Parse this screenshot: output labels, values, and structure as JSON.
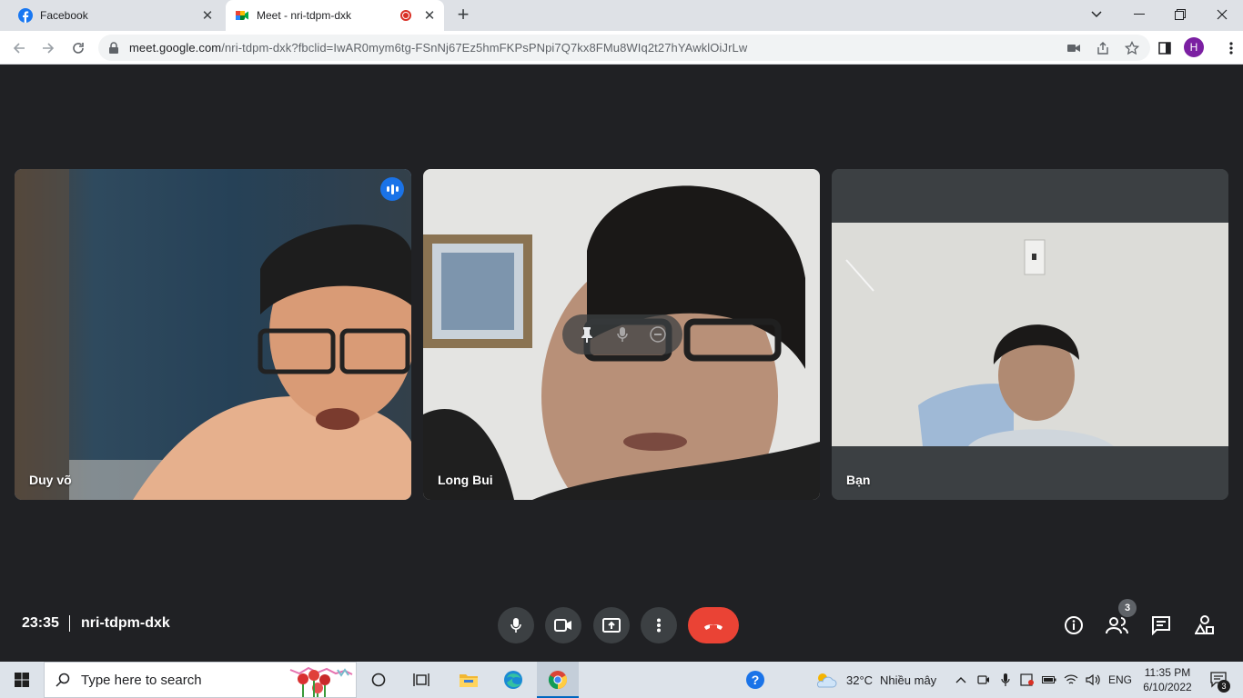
{
  "browser": {
    "tabs": [
      {
        "title": "Facebook",
        "favicon": "facebook-icon",
        "active": false
      },
      {
        "title": "Meet - nri-tdpm-dxk",
        "favicon": "google-meet-icon",
        "active": true,
        "recording_indicator": true
      }
    ],
    "url": {
      "host": "meet.google.com",
      "path": "/nri-tdpm-dxk?fbclid=IwAR0mym6tg-FSnNj67Ez5hmFKPsPNpi7Q7kx8FMu8WIq2t27hYAwklOiJrLw"
    },
    "profile_initial": "H"
  },
  "meeting": {
    "participants": [
      {
        "name": "Duy võ",
        "speaking": true,
        "avatar_color": "#3a4a5c"
      },
      {
        "name": "Long Bui",
        "speaking": false,
        "avatar_color": "#d8d8d6"
      },
      {
        "name": "Bạn",
        "speaking": false,
        "avatar_color": "#dcdcd8"
      }
    ],
    "time": "23:35",
    "meeting_code": "nri-tdpm-dxk",
    "people_count": "3",
    "colors": {
      "background": "#202124",
      "end_call": "#ea4335",
      "accent": "#8ab4f8"
    }
  },
  "taskbar": {
    "search_placeholder": "Type here to search",
    "weather_temp": "32°C",
    "weather_text": "Nhiều mây",
    "language": "ENG",
    "clock_time": "11:35 PM",
    "clock_date": "6/10/2022",
    "notification_count": "3"
  }
}
